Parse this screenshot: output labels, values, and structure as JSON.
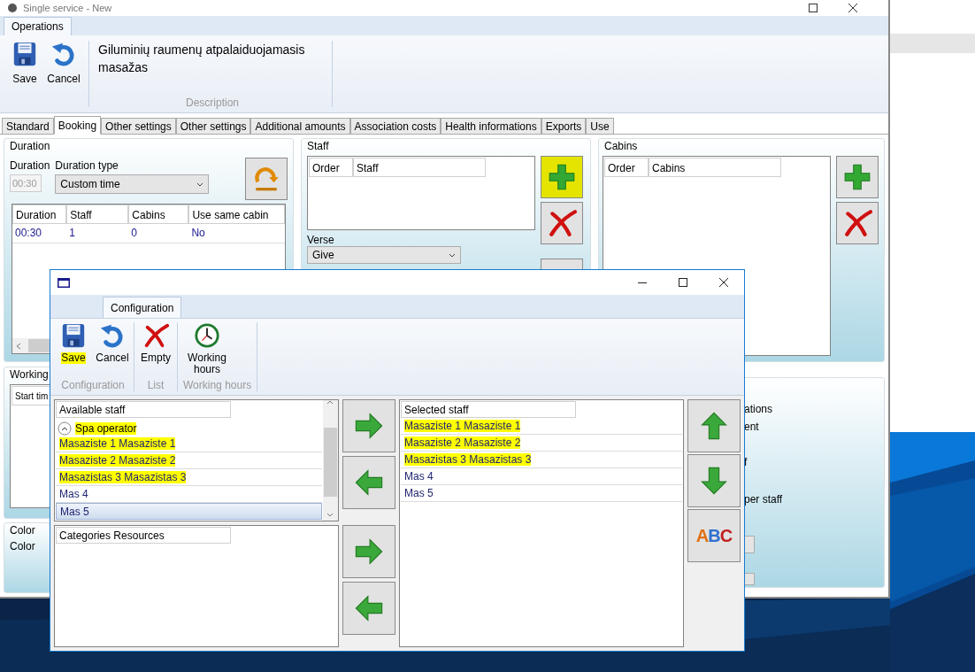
{
  "main_window": {
    "title": "Single service - New",
    "ribbon_tabs": [
      {
        "label": "Operations",
        "selected": true
      }
    ],
    "ribbon_buttons": [
      {
        "label": "Save",
        "kind": "save"
      },
      {
        "label": "Cancel",
        "kind": "cancel"
      }
    ],
    "description": "Giluminių raumenų atpalaiduojamasis masažas",
    "description_group": "Description",
    "tabs": [
      {
        "label": "Standard",
        "selected": false
      },
      {
        "label": "Booking",
        "selected": true
      },
      {
        "label": "Other settings",
        "selected": false
      },
      {
        "label": "Other settings",
        "selected": false
      },
      {
        "label": "Additional amounts",
        "selected": false
      },
      {
        "label": "Association costs",
        "selected": false
      },
      {
        "label": "Health informations",
        "selected": false
      },
      {
        "label": "Exports",
        "selected": false
      },
      {
        "label": "Use",
        "selected": false
      }
    ],
    "duration": {
      "title": "Duration",
      "duration_label": "Duration",
      "duration_value": "00:30",
      "type_label": "Duration type",
      "type_value": "Custom time",
      "columns": [
        "Duration",
        "Staff",
        "Cabins",
        "Use same cabin"
      ],
      "rows": [
        [
          "00:30",
          "1",
          "0",
          "No"
        ]
      ]
    },
    "staff": {
      "title": "Staff",
      "columns": [
        "Order",
        "Staff"
      ],
      "buttons": [
        {
          "kind": "add",
          "highlighted": true
        },
        {
          "kind": "delete",
          "highlighted": false
        }
      ],
      "verse_label": "Verse",
      "verse_value": "Give"
    },
    "cabins": {
      "title": "Cabins",
      "columns": [
        "Order",
        "Cabins"
      ],
      "buttons": [
        {
          "kind": "add",
          "highlighted": false
        },
        {
          "kind": "delete",
          "highlighted": false
        }
      ]
    },
    "working": {
      "title": "Working",
      "column": "Start tim"
    },
    "color": {
      "title": "Color",
      "label": "Color"
    },
    "options": [
      "ations",
      "ent",
      "f",
      "per staff"
    ]
  },
  "dialog": {
    "tabs": [
      {
        "label": "Configuration",
        "selected": true
      }
    ],
    "groups": [
      {
        "label": "Configuration",
        "buttons": [
          {
            "label": "Save",
            "kind": "save",
            "highlighted": true
          },
          {
            "label": "Cancel",
            "kind": "cancel",
            "highlighted": false
          }
        ]
      },
      {
        "label": "List",
        "buttons": [
          {
            "label": "Empty",
            "kind": "empty",
            "highlighted": false
          }
        ]
      },
      {
        "label": "Working hours",
        "buttons": [
          {
            "label": "Working hours",
            "kind": "clock",
            "highlighted": false
          }
        ]
      }
    ],
    "available_header": "Available staff",
    "available_group": {
      "label": "Spa operator",
      "expanded": true,
      "highlighted": true
    },
    "available": [
      {
        "label": "Masaziste 1 Masaziste 1",
        "highlighted": true,
        "selected": false
      },
      {
        "label": "Masaziste 2 Masaziste 2",
        "highlighted": true,
        "selected": false
      },
      {
        "label": "Masazistas 3 Masazistas 3",
        "highlighted": true,
        "selected": false
      },
      {
        "label": "Mas 4",
        "highlighted": false,
        "selected": false
      },
      {
        "label": "Mas 5",
        "highlighted": false,
        "selected": true
      }
    ],
    "categories_header": "Categories Resources",
    "selected_header": "Selected staff",
    "selected_staff": [
      {
        "label": "Masaziste 1 Masaziste 1",
        "highlighted": true
      },
      {
        "label": "Masaziste 2 Masaziste 2",
        "highlighted": true
      },
      {
        "label": "Masazistas 3 Masazistas 3",
        "highlighted": true
      },
      {
        "label": "Mas 4",
        "highlighted": false
      },
      {
        "label": "Mas 5",
        "highlighted": false
      }
    ],
    "abc_label": "ABC"
  }
}
